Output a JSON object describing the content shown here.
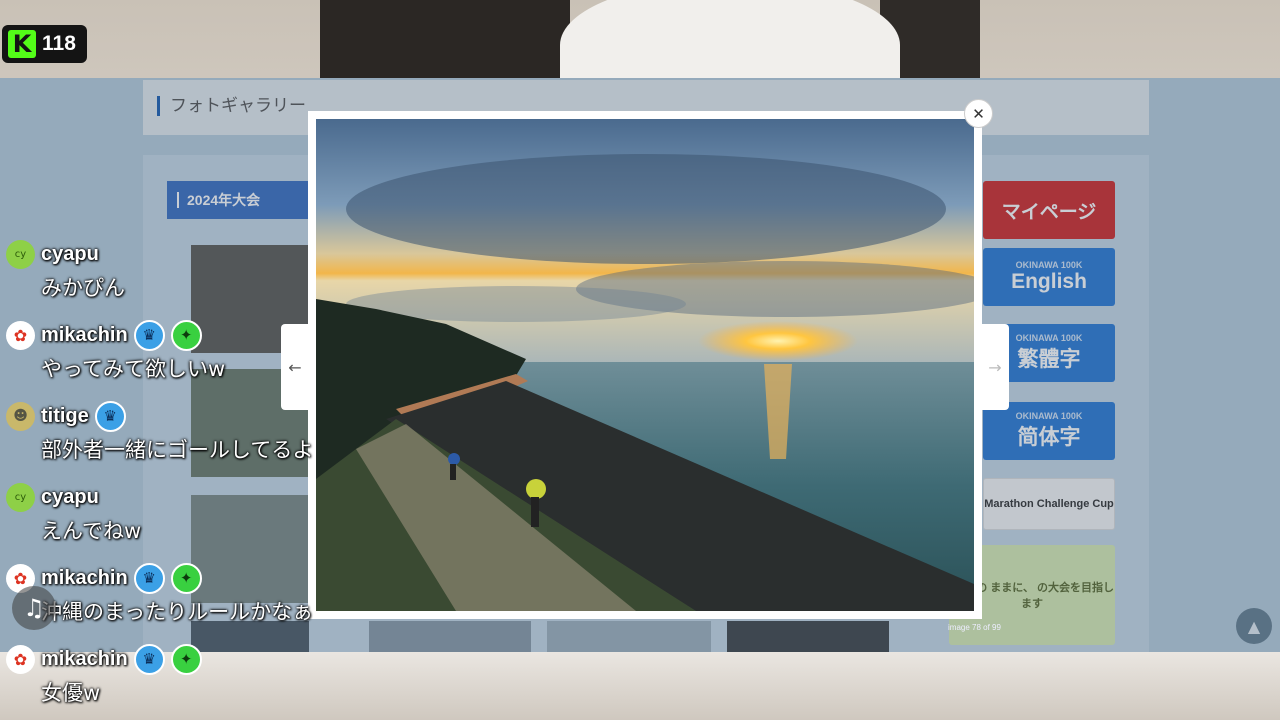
{
  "stream": {
    "viewer_count": "118",
    "logo_letter": "K",
    "logo_color": "#53fc18"
  },
  "page": {
    "section_title": "フォトギャラリー",
    "year_tab": "2024年大会",
    "side_buttons": {
      "mypage": "マイページ",
      "english": "English",
      "traditional": "繁體字",
      "simplified": "简体字",
      "okinawa_label": "OKINAWA 100K",
      "marathon_cup": "Marathon Challenge Cup",
      "banner_text": "100Kの ままに、 の大会を目指します"
    },
    "scroll_top_icon": "chevron-up-icon",
    "accent_blue": "#3a6fc2",
    "accent_red": "#d12a2a"
  },
  "lightbox": {
    "close_icon": "close-icon",
    "prev_icon": "arrow-left-icon",
    "next_icon": "arrow-right-icon",
    "counter": "image 78 of 99",
    "photo_subject": "sunset over the sea with runners on a seawall path"
  },
  "chat": {
    "messages": [
      {
        "user": "cyapu",
        "avatar": "cy",
        "badges": [],
        "text": "みかぴん"
      },
      {
        "user": "mikachin",
        "avatar": "",
        "badges": [
          "crown",
          "star"
        ],
        "text": "やってみて欲しいw"
      },
      {
        "user": "titige",
        "avatar": "",
        "badges": [
          "crown"
        ],
        "text": "部外者一緒にゴールしてるよ"
      },
      {
        "user": "cyapu",
        "avatar": "cy",
        "badges": [],
        "text": "えんでねw"
      },
      {
        "user": "mikachin",
        "avatar": "",
        "badges": [
          "crown",
          "star"
        ],
        "text": "沖縄のまったりルールかなぁ"
      },
      {
        "user": "mikachin",
        "avatar": "",
        "badges": [
          "crown",
          "star"
        ],
        "text": "女優w"
      }
    ]
  }
}
